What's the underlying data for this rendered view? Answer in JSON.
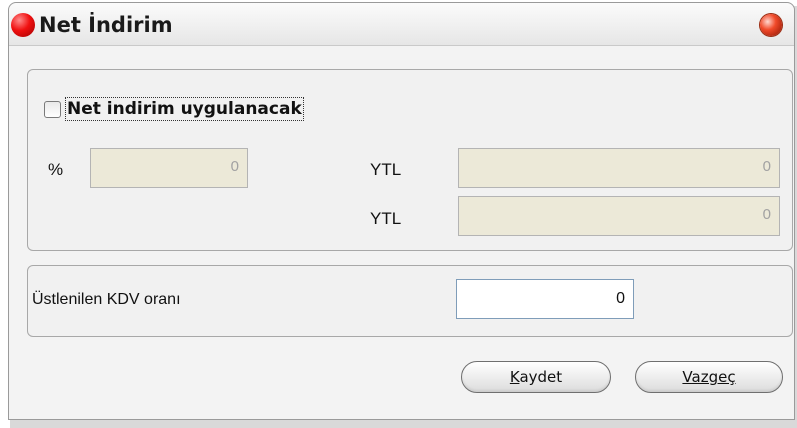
{
  "window": {
    "title": "Net İndirim",
    "icon": "red-sphere-icon",
    "close_icon": "close-icon"
  },
  "discount_group": {
    "checkbox_label": "Net indirim uygulanacak",
    "checkbox_checked": false,
    "percent_label": "%",
    "percent_value": "0",
    "ytl_label_1": "YTL",
    "ytl_value_1": "0",
    "ytl_label_2": "YTL",
    "ytl_value_2": "0"
  },
  "kdv_group": {
    "label": "Üstlenilen KDV oranı",
    "value": "0"
  },
  "buttons": {
    "save_first": "K",
    "save_rest": "aydet",
    "cancel_first": "V",
    "cancel_rest": "azgeç"
  },
  "colors": {
    "dialog_bg": "#f3f3f3",
    "disabled_field_bg": "#ece9d8",
    "active_field_border": "#7f9db9"
  }
}
